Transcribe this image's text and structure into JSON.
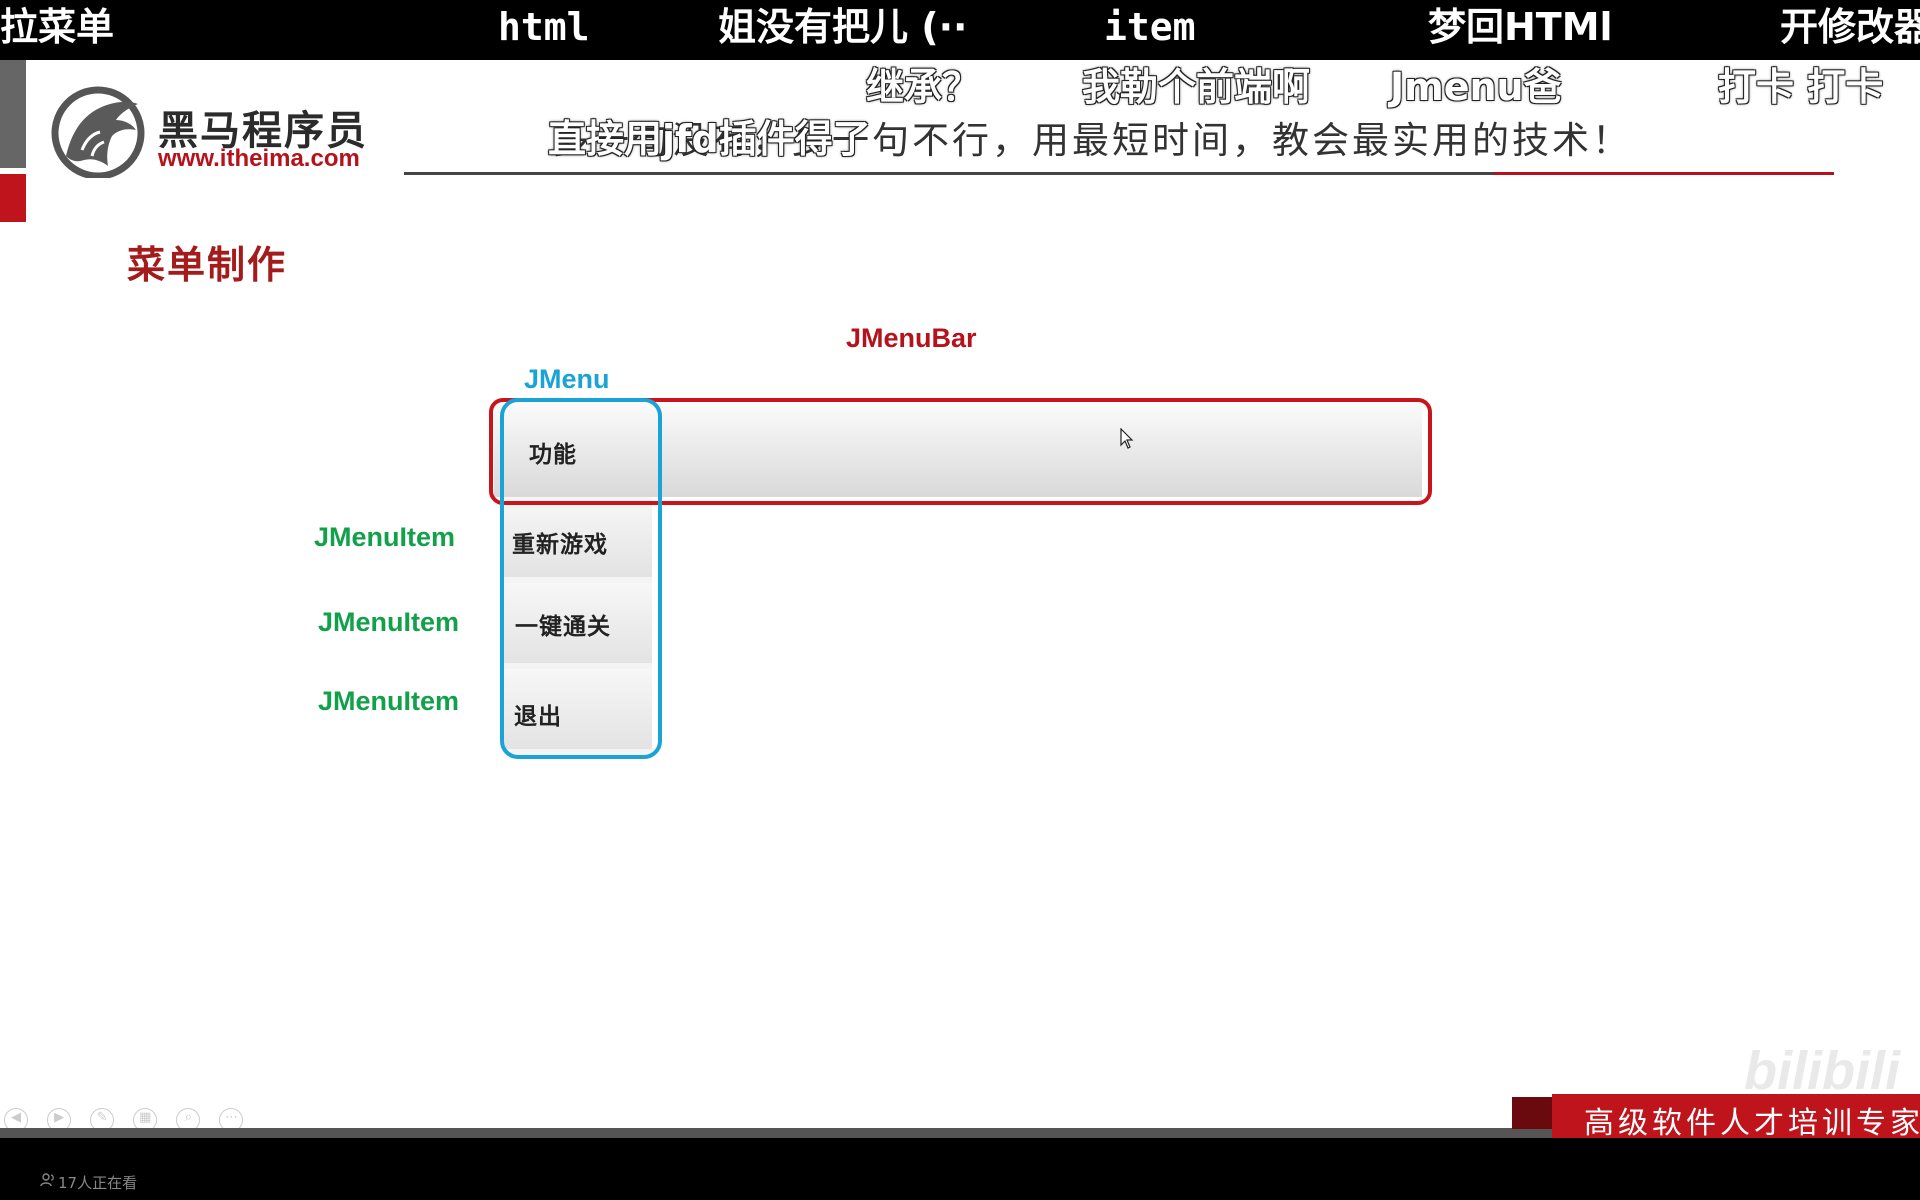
{
  "danmaku": {
    "top_row": [
      "拉菜单",
      "html",
      "姐没有把儿 (··",
      "item",
      "梦回HTMl",
      "开修改器"
    ],
    "floating": [
      "继承？",
      "我勒个前端啊",
      "Jmenu爸",
      "打卡 打卡",
      "直接用jfd插件得了"
    ]
  },
  "header": {
    "brand_name": "黑马程序员",
    "brand_url": "www.itheima.com",
    "slogan": "多一句没有，少一句不行，用最短时间，教会最实用的技术！"
  },
  "slide": {
    "title": "菜单制作",
    "labels": {
      "menubar": "JMenuBar",
      "menu": "JMenu",
      "menu_items": [
        "JMenuItem",
        "JMenuItem",
        "JMenuItem"
      ]
    },
    "menu": {
      "title": "功能",
      "items": [
        "重新游戏",
        "一键通关",
        "退出"
      ]
    }
  },
  "footer": {
    "tagline": "高级软件人才培训专家",
    "watermark": "bilibili",
    "viewer_count": "17人正在看"
  },
  "colors": {
    "brand_red": "#c0141c",
    "menubar_outline": "#c8151c",
    "menu_outline": "#1aa3d6",
    "menuitem_label": "#12a04b"
  }
}
